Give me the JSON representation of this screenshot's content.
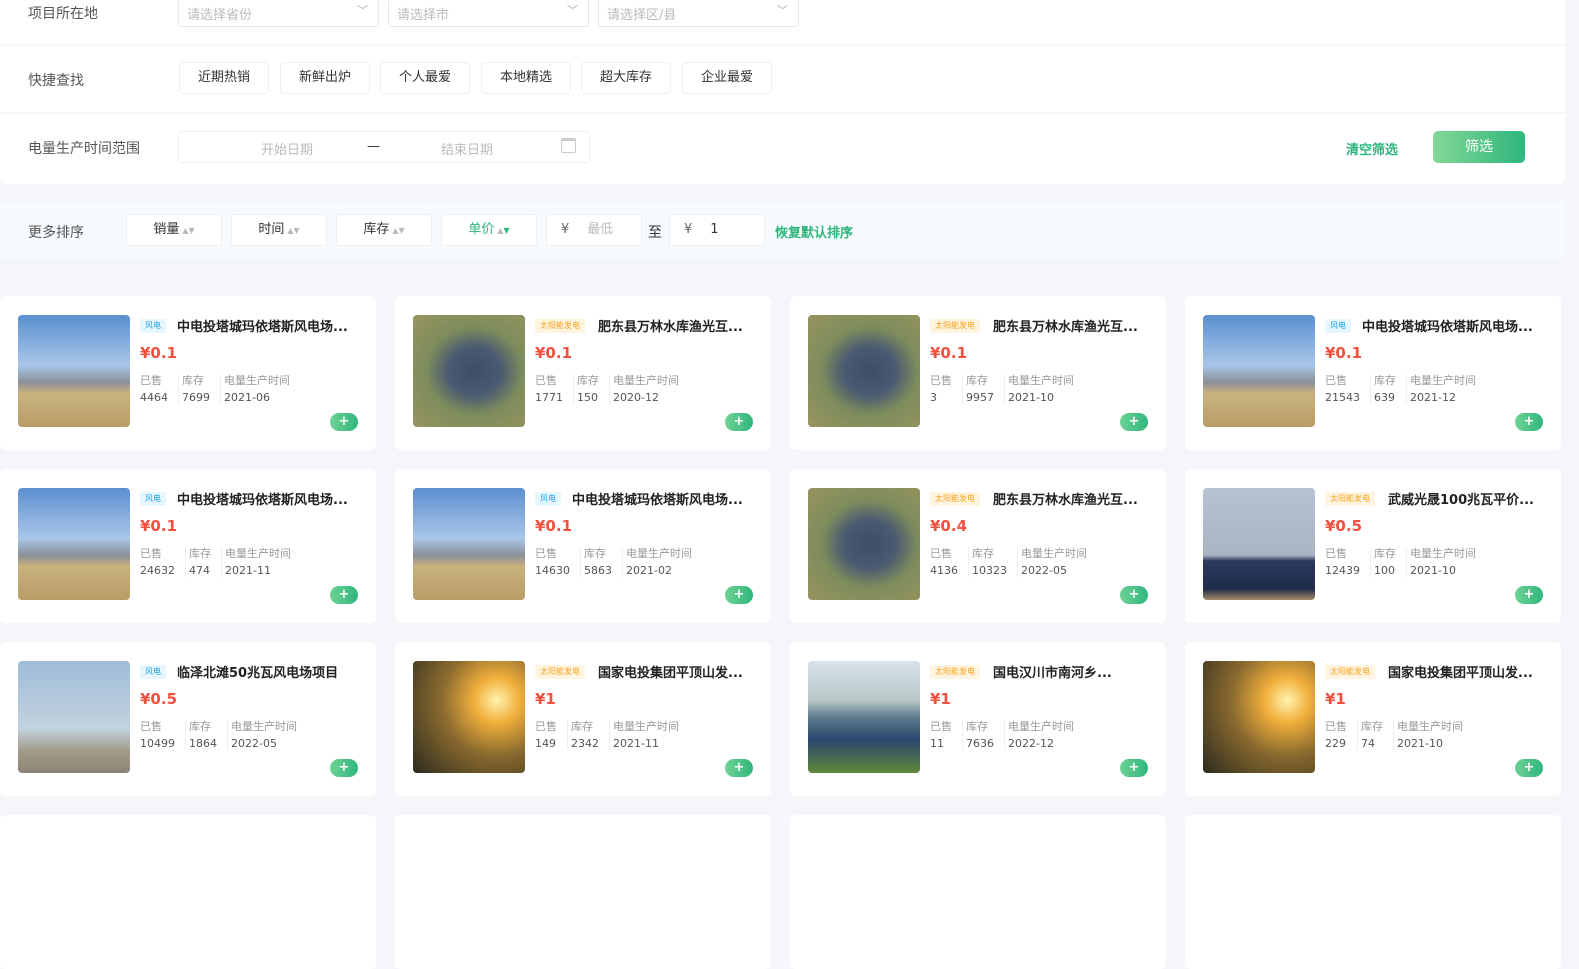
{
  "filters": {
    "location_label": "项目所在地",
    "province_placeholder": "请选择省份",
    "city_placeholder": "请选择市",
    "district_placeholder": "请选择区/县",
    "quick_label": "快捷查找",
    "quick": [
      "近期热销",
      "新鲜出炉",
      "个人最爱",
      "本地精选",
      "超大库存",
      "企业最爱"
    ],
    "date_label": "电量生产时间范围",
    "start_placeholder": "开始日期",
    "end_placeholder": "结束日期",
    "dash": "—",
    "clear": "清空筛选",
    "filter": "筛选"
  },
  "sort": {
    "label": "更多排序",
    "items": [
      "销量",
      "时间",
      "库存",
      "单价"
    ],
    "active": "单价",
    "currency": "¥",
    "min_placeholder": "最低",
    "to": "至",
    "max_value": "1",
    "reset": "恢复默认排序"
  },
  "card_labels": {
    "sold": "已售",
    "stock": "库存",
    "time": "电量生产时间",
    "add": "+"
  },
  "colors": {
    "accent": "#2fb67d",
    "price": "#f4503f"
  },
  "products": [
    {
      "type": "wind",
      "tag": "风电",
      "title": "中电投塔城玛依塔斯风电场...",
      "price": "¥0.1",
      "sold": "4464",
      "stock": "7699",
      "time": "2021-06",
      "img": "station"
    },
    {
      "type": "solar",
      "tag": "太阳能发电",
      "title": "肥东县万林水库渔光互...",
      "price": "¥0.1",
      "sold": "1771",
      "stock": "150",
      "time": "2020-12",
      "img": "lake"
    },
    {
      "type": "solar",
      "tag": "太阳能发电",
      "title": "肥东县万林水库渔光互...",
      "price": "¥0.1",
      "sold": "3",
      "stock": "9957",
      "time": "2021-10",
      "img": "lake"
    },
    {
      "type": "wind",
      "tag": "风电",
      "title": "中电投塔城玛依塔斯风电场...",
      "price": "¥0.1",
      "sold": "21543",
      "stock": "639",
      "time": "2021-12",
      "img": "station"
    },
    {
      "type": "wind",
      "tag": "风电",
      "title": "中电投塔城玛依塔斯风电场...",
      "price": "¥0.1",
      "sold": "24632",
      "stock": "474",
      "time": "2021-11",
      "img": "station"
    },
    {
      "type": "wind",
      "tag": "风电",
      "title": "中电投塔城玛依塔斯风电场...",
      "price": "¥0.1",
      "sold": "14630",
      "stock": "5863",
      "time": "2021-02",
      "img": "station"
    },
    {
      "type": "solar",
      "tag": "太阳能发电",
      "title": "肥东县万林水库渔光互...",
      "price": "¥0.4",
      "sold": "4136",
      "stock": "10323",
      "time": "2022-05",
      "img": "lake"
    },
    {
      "type": "solar",
      "tag": "太阳能发电",
      "title": "武威光晟100兆瓦平价...",
      "price": "¥0.5",
      "sold": "12439",
      "stock": "100",
      "time": "2021-10",
      "img": "panels"
    },
    {
      "type": "wind",
      "tag": "风电",
      "title": "临泽北滩50兆瓦风电场项目",
      "price": "¥0.5",
      "sold": "10499",
      "stock": "1864",
      "time": "2022-05",
      "img": "turbine"
    },
    {
      "type": "solar",
      "tag": "太阳能发电",
      "title": "国家电投集团平顶山发...",
      "price": "¥1",
      "sold": "149",
      "stock": "2342",
      "time": "2021-11",
      "img": "sunset"
    },
    {
      "type": "solar",
      "tag": "太阳能发电",
      "title": "国电汉川市南河乡...",
      "price": "¥1",
      "sold": "11",
      "stock": "7636",
      "time": "2022-12",
      "img": "field"
    },
    {
      "type": "solar",
      "tag": "太阳能发电",
      "title": "国家电投集团平顶山发...",
      "price": "¥1",
      "sold": "229",
      "stock": "74",
      "time": "2021-10",
      "img": "sunset"
    }
  ]
}
